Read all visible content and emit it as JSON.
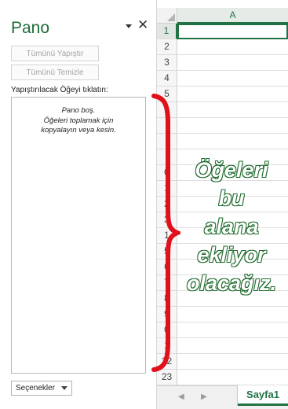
{
  "pane": {
    "title": "Pano",
    "close_glyph": "✕",
    "paste_all_label": "Tümünü Yapıştır",
    "clear_all_label": "Tümünü Temizle",
    "paste_item_label": "Yapıştırılacak Öğeyi tıklatın:",
    "empty_message": [
      "Pano boş.",
      "Öğeleri toplamak için",
      "kopyalayın veya kesin."
    ],
    "options_label": "Seçenekler"
  },
  "sheet": {
    "column_header": "A",
    "selected_row": "1",
    "rows": [
      "1",
      "2",
      "3",
      "4",
      "5",
      "",
      "",
      "",
      "",
      "0",
      "1",
      "2",
      "3",
      "1",
      "5",
      "6",
      "7",
      "8",
      "9",
      "0",
      "1",
      "22",
      "23"
    ],
    "tab_label": "Sayfa1",
    "nav_left_glyph": "◀",
    "nav_right_glyph": "▶"
  },
  "annotation": {
    "lines": [
      "Öğeleri",
      "bu",
      "alana",
      "ekliyor",
      "olacağız."
    ],
    "text_color": "#ffffff",
    "outline_color": "#1f6b2e",
    "brace_color": "#e0111b"
  },
  "colors": {
    "accent_green": "#217346",
    "title_green": "#1e6b3a"
  }
}
